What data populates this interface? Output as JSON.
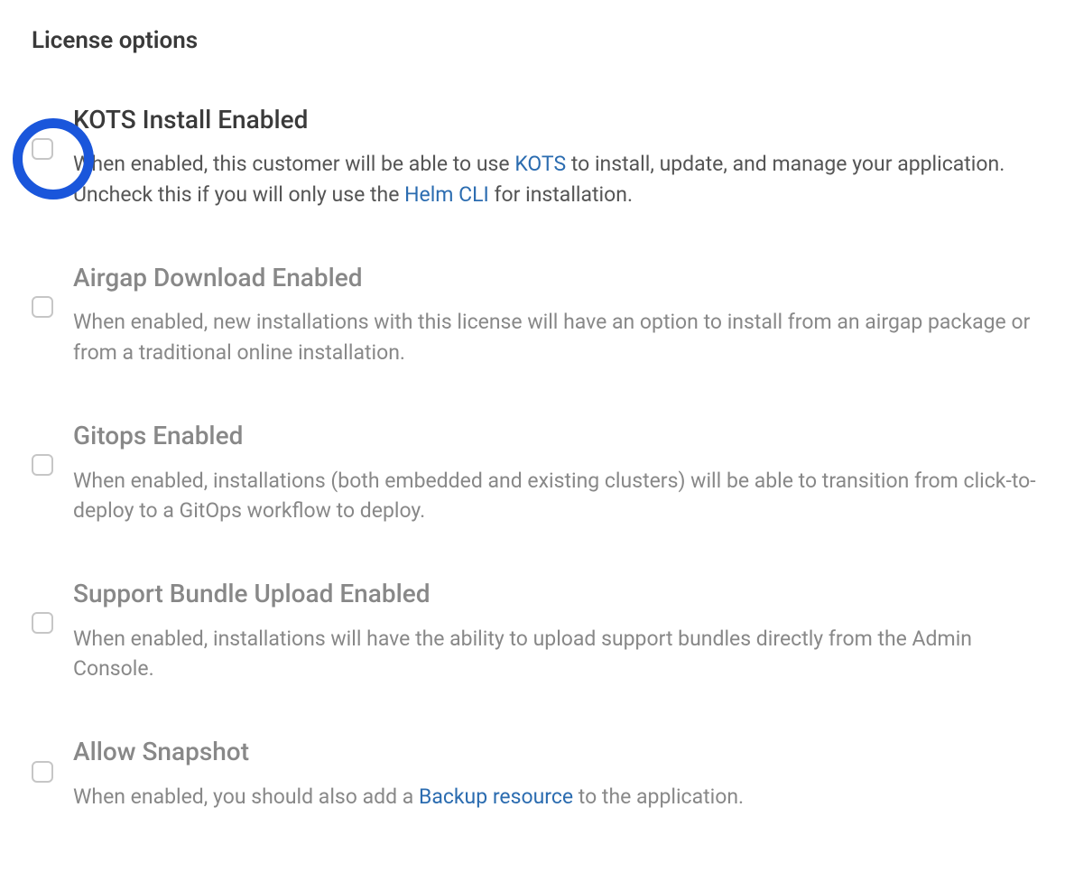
{
  "section_title": "License options",
  "options": {
    "kots_install": {
      "title": "KOTS Install Enabled",
      "desc_part1": "When enabled, this customer will be able to use ",
      "link1": "KOTS",
      "desc_part2": " to install, update, and manage your application. Uncheck this if you will only use the ",
      "link2": "Helm CLI",
      "desc_part3": " for installation."
    },
    "airgap": {
      "title": "Airgap Download Enabled",
      "description": "When enabled, new installations with this license will have an option to install from an airgap package or from a traditional online installation."
    },
    "gitops": {
      "title": "Gitops Enabled",
      "description": "When enabled, installations (both embedded and existing clusters) will be able to transition from click-to-deploy to a GitOps workflow to deploy."
    },
    "support_bundle": {
      "title": "Support Bundle Upload Enabled",
      "description": "When enabled, installations will have the ability to upload support bundles directly from the Admin Console."
    },
    "snapshot": {
      "title": "Allow Snapshot",
      "desc_part1": "When enabled, you should also add a ",
      "link1": "Backup resource",
      "desc_part2": " to the application."
    }
  }
}
